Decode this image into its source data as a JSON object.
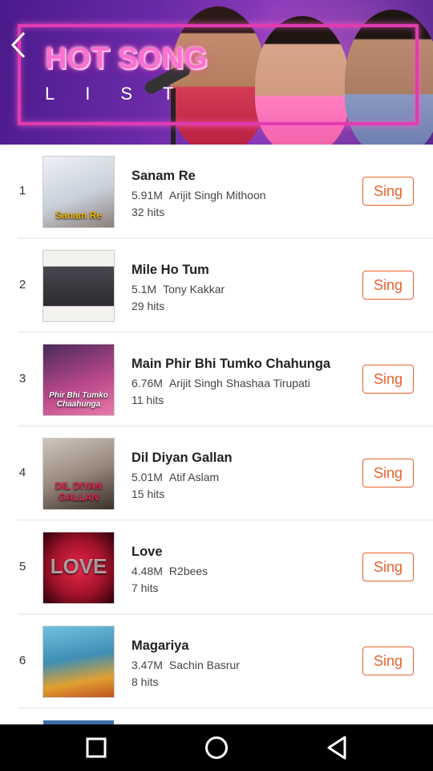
{
  "banner": {
    "title": "HOT SONG",
    "subtitle": "LIST",
    "back_icon": "chevron-left-icon"
  },
  "songs": [
    {
      "rank": "1",
      "title": "Sanam Re",
      "plays": "5.91M",
      "artist": "Arijit Singh Mithoon",
      "hits": "32 hits",
      "action": "Sing",
      "thumb_color": "#d9dde6",
      "thumb_text": "Sanam Re"
    },
    {
      "rank": "2",
      "title": "Mile Ho Tum",
      "plays": "5.1M",
      "artist": "Tony Kakkar",
      "hits": "29 hits",
      "action": "Sing",
      "thumb_color": "#3c3a3e",
      "thumb_text": ""
    },
    {
      "rank": "3",
      "title": "Main Phir Bhi Tumko Chahunga",
      "plays": "6.76M",
      "artist": "Arijit Singh Shashaa Tirupati",
      "hits": "11 hits",
      "action": "Sing",
      "thumb_color": "#b6478a",
      "thumb_text": "Phir Bhi Tumko Chaahunga"
    },
    {
      "rank": "4",
      "title": "Dil Diyan Gallan",
      "plays": "5.01M",
      "artist": "Atif Aslam",
      "hits": "15 hits",
      "action": "Sing",
      "thumb_color": "#9a8a7e",
      "thumb_text": "DIL DIYAN GALLAN"
    },
    {
      "rank": "5",
      "title": "Love",
      "plays": "4.48M",
      "artist": "R2bees",
      "hits": "7 hits",
      "action": "Sing",
      "thumb_color": "#a1122a",
      "thumb_text": "LOVE"
    },
    {
      "rank": "6",
      "title": "Magariya",
      "plays": "3.47M",
      "artist": "Sachin Basrur",
      "hits": "8 hits",
      "action": "Sing",
      "thumb_color": "#3f8fb3",
      "thumb_text": ""
    }
  ],
  "navbar": {
    "recents_icon": "square-icon",
    "home_icon": "circle-icon",
    "back_icon": "triangle-back-icon"
  }
}
